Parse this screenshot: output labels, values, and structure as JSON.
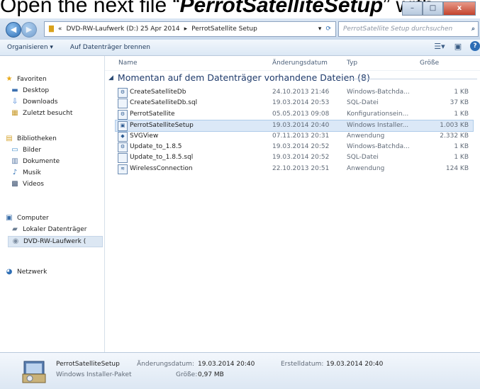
{
  "caption": {
    "prefix": "Open the next file “",
    "filename": "PerrotSatelliteSetup",
    "suffix": "” with"
  },
  "window_buttons": {
    "minimize": "–",
    "maximize": "□",
    "close": "x"
  },
  "address": {
    "chevron": "«",
    "segments": [
      "DVD-RW-Laufwerk (D:) 25 Apr 2014",
      "PerrotSatellite Setup"
    ],
    "separator": "▸",
    "search_placeholder": "PerrotSatellite Setup durchsuchen"
  },
  "toolbar": {
    "organize": "Organisieren ▾",
    "burn": "Auf Datenträger brennen"
  },
  "nav": {
    "favorites": "Favoriten",
    "fav_items": [
      "Desktop",
      "Downloads",
      "Zuletzt besucht"
    ],
    "libraries": "Bibliotheken",
    "lib_items": [
      "Bilder",
      "Dokumente",
      "Musik",
      "Videos"
    ],
    "computer": "Computer",
    "comp_items": [
      "Lokaler Datenträger",
      "DVD-RW-Laufwerk ("
    ],
    "network": "Netzwerk"
  },
  "columns": {
    "name": "Name",
    "date": "Änderungsdatum",
    "type": "Typ",
    "size": "Größe"
  },
  "group": "Momentan auf dem Datenträger vorhandene Dateien (8)",
  "files": [
    {
      "name": "CreateSatelliteDb",
      "date": "24.10.2013 21:46",
      "type": "Windows-Batchda...",
      "size": "1 KB",
      "icon": "batch-file-icon",
      "selected": false
    },
    {
      "name": "CreateSatelliteDb.sql",
      "date": "19.03.2014 20:53",
      "type": "SQL-Datei",
      "size": "37 KB",
      "icon": "document-file-icon",
      "selected": false
    },
    {
      "name": "PerrotSatellite",
      "date": "05.05.2013 09:08",
      "type": "Konfigurationsein...",
      "size": "1 KB",
      "icon": "config-file-icon",
      "selected": false
    },
    {
      "name": "PerrotSatelliteSetup",
      "date": "19.03.2014 20:40",
      "type": "Windows Installer...",
      "size": "1.003 KB",
      "icon": "installer-file-icon",
      "selected": true
    },
    {
      "name": "SVGView",
      "date": "07.11.2013 20:31",
      "type": "Anwendung",
      "size": "2.332 KB",
      "icon": "application-icon",
      "selected": false
    },
    {
      "name": "Update_to_1.8.5",
      "date": "19.03.2014 20:52",
      "type": "Windows-Batchda...",
      "size": "1 KB",
      "icon": "batch-file-icon",
      "selected": false
    },
    {
      "name": "Update_to_1.8.5.sql",
      "date": "19.03.2014 20:52",
      "type": "SQL-Datei",
      "size": "1 KB",
      "icon": "document-file-icon",
      "selected": false
    },
    {
      "name": "WirelessConnection",
      "date": "22.10.2013 20:51",
      "type": "Anwendung",
      "size": "124 KB",
      "icon": "wireless-icon",
      "selected": false
    }
  ],
  "details": {
    "name": "PerrotSatelliteSetup",
    "kind": "Windows Installer-Paket",
    "modified_label": "Änderungsdatum:",
    "modified_value": "19.03.2014 20:40",
    "size_label": "Größe:",
    "size_value": "0,97 MB",
    "created_label": "Erstelldatum:",
    "created_value": "19.03.2014 20:40"
  }
}
